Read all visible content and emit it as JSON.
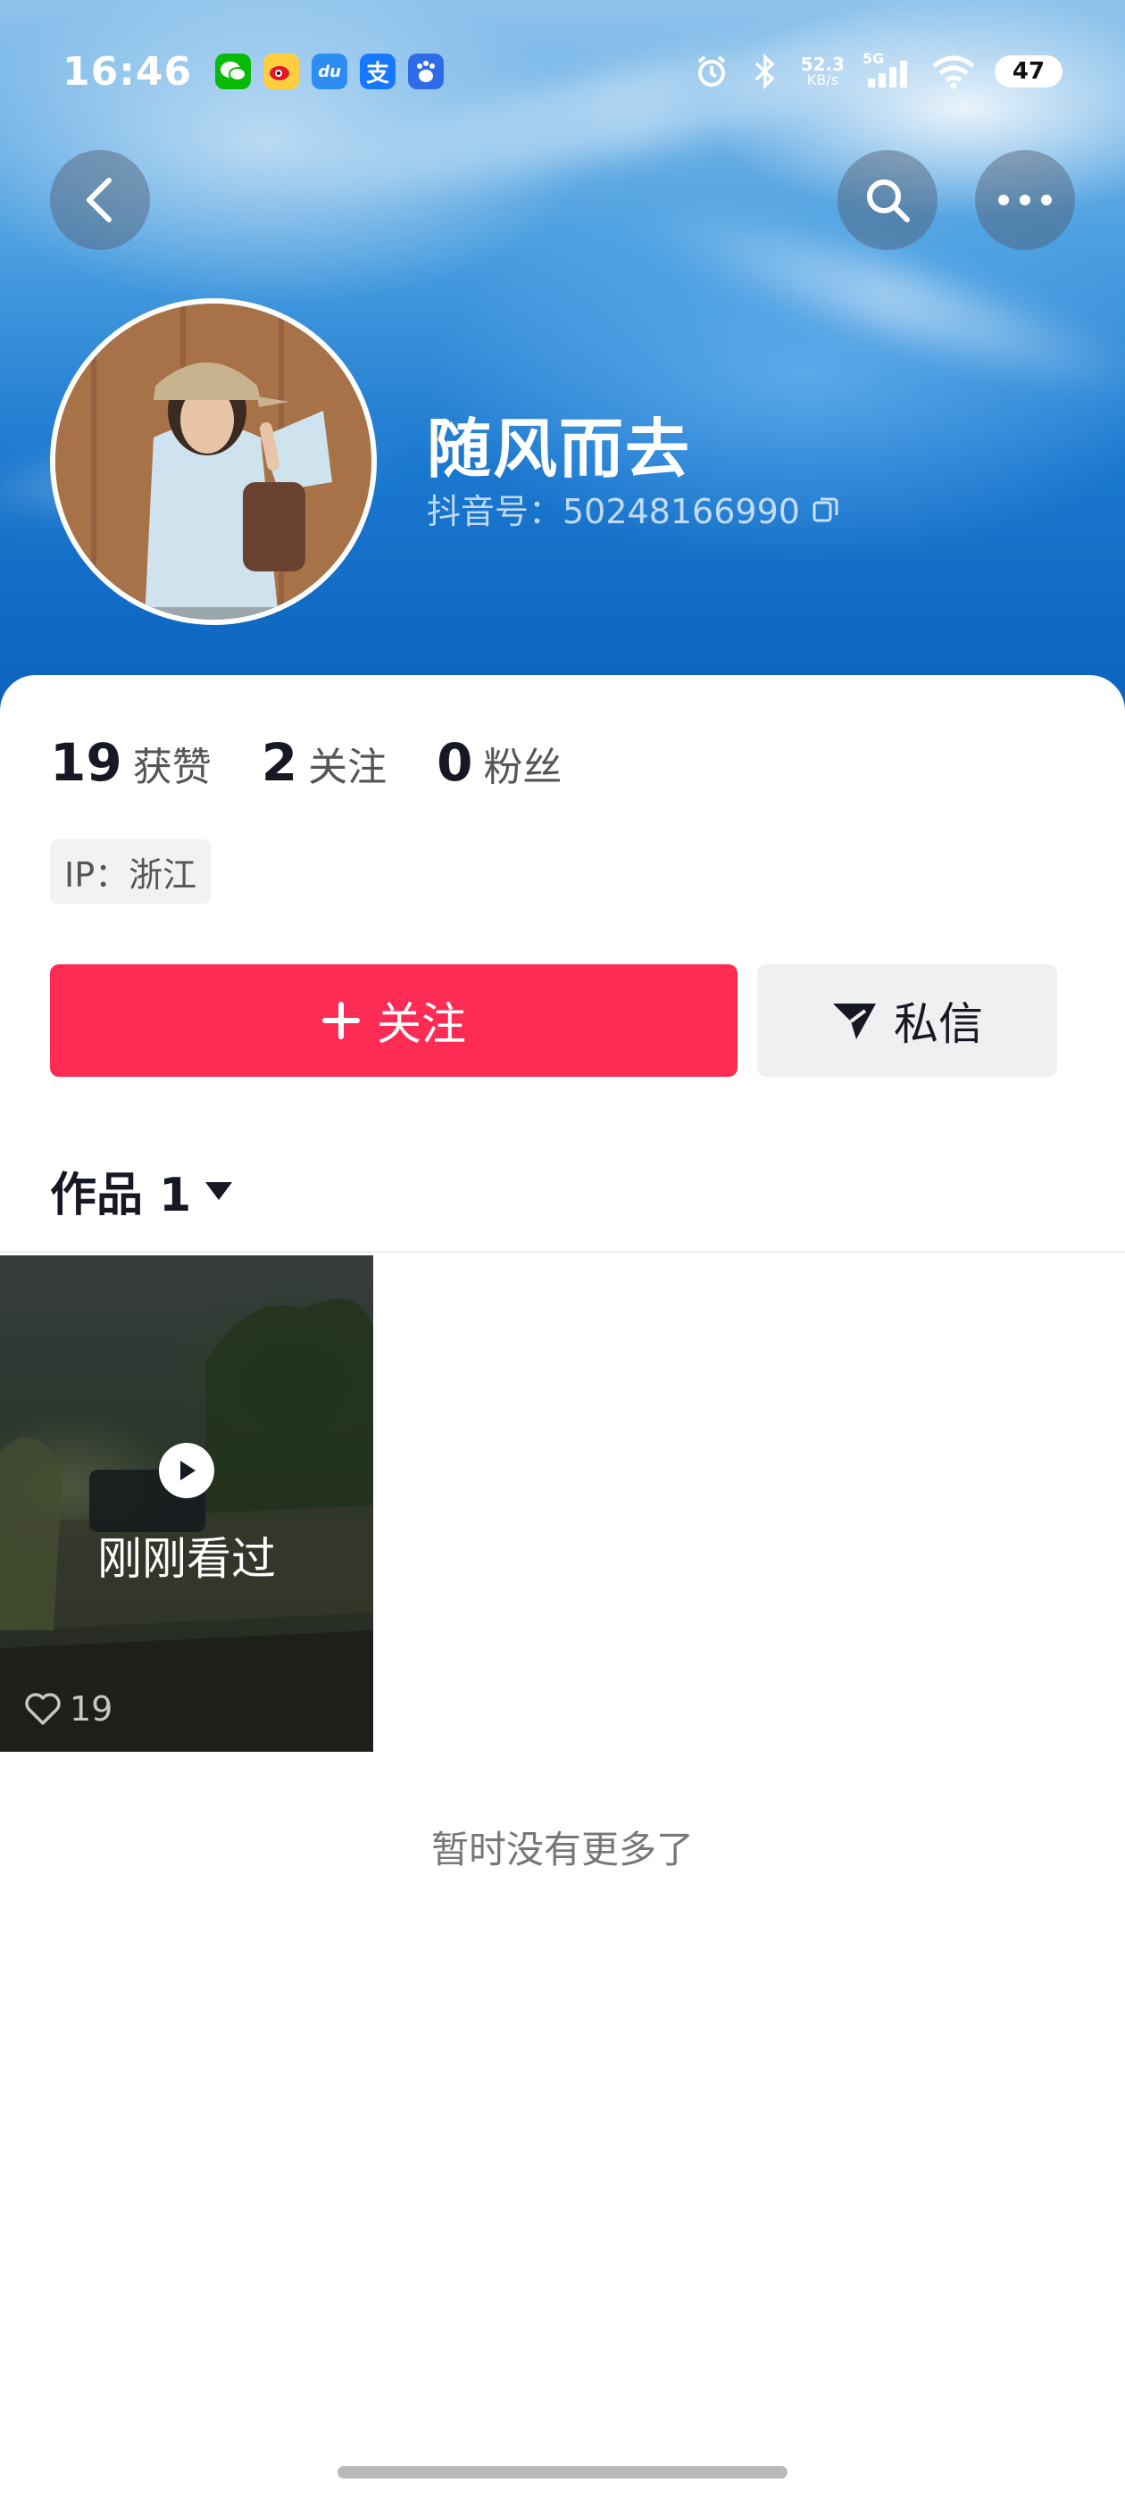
{
  "status_bar": {
    "time": "16:46",
    "net_speed_value": "52.3",
    "net_speed_unit": "KB/s",
    "network_type": "5G",
    "battery": "47",
    "apps": [
      "wechat-icon",
      "weibo-icon",
      "du-icon",
      "alipay-icon",
      "baidu-icon"
    ]
  },
  "profile": {
    "name": "随风而去",
    "douyin_id": "抖音号：50248166990"
  },
  "stats": {
    "likes_count": "19",
    "likes_label": "获赞",
    "following_count": "2",
    "following_label": "关注",
    "followers_count": "0",
    "followers_label": "粉丝"
  },
  "ip_location": "IP：浙江",
  "actions": {
    "follow_label": "关注",
    "message_label": "私信"
  },
  "works": {
    "tab_label": "作品 1",
    "items": [
      {
        "overlay_label": "刚刚看过",
        "likes": "19"
      }
    ]
  },
  "footer": {
    "no_more_text": "暂时没有更多了"
  },
  "colors": {
    "accent": "#fe2c55",
    "header_blue": "#1b78cf"
  }
}
